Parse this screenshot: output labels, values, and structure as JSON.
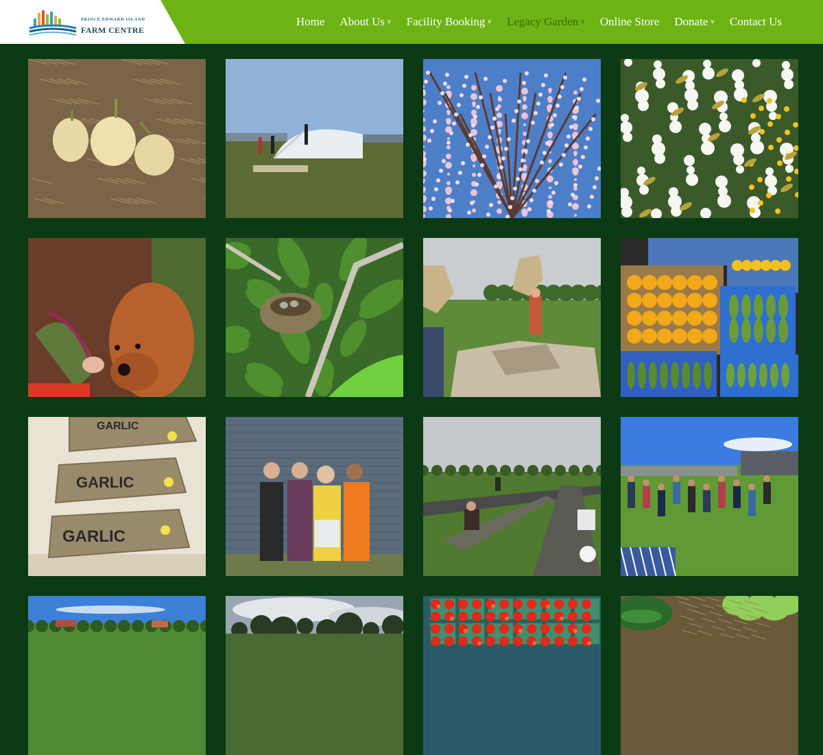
{
  "brand": {
    "small_text": "PRINCE EDWARD ISLAND",
    "name": "FARM CENTRE"
  },
  "nav": [
    {
      "label": "Home",
      "has_dropdown": false,
      "active": false
    },
    {
      "label": "About Us",
      "has_dropdown": true,
      "active": false
    },
    {
      "label": "Facility Booking",
      "has_dropdown": true,
      "active": false
    },
    {
      "label": "Legacy Garden",
      "has_dropdown": true,
      "active": true
    },
    {
      "label": "Online Store",
      "has_dropdown": false,
      "active": false
    },
    {
      "label": "Donate",
      "has_dropdown": true,
      "active": false
    },
    {
      "label": "Contact Us",
      "has_dropdown": false,
      "active": false
    }
  ],
  "gallery": [
    {
      "subject": "acorn squash on straw"
    },
    {
      "subject": "greenhouse construction"
    },
    {
      "subject": "pink blossom tree"
    },
    {
      "subject": "white pear blossoms"
    },
    {
      "subject": "golden retriever with beets"
    },
    {
      "subject": "bird nest with eggs"
    },
    {
      "subject": "garden workshop"
    },
    {
      "subject": "harvest crates of squash and cucumbers"
    },
    {
      "subject": "garlic burlap sacks",
      "sack_label": "GARLIC"
    },
    {
      "subject": "volunteers by shed"
    },
    {
      "subject": "weeding garden rows"
    },
    {
      "subject": "group gathering in field"
    },
    {
      "subject": "farm landscape"
    },
    {
      "subject": "cloudy sky with trees"
    },
    {
      "subject": "cherry tomatoes in baskets"
    },
    {
      "subject": "squash plants"
    }
  ],
  "colors": {
    "nav_bg": "#6db313",
    "page_bg": "#0b3a14",
    "nav_active": "#3d6a0d"
  }
}
